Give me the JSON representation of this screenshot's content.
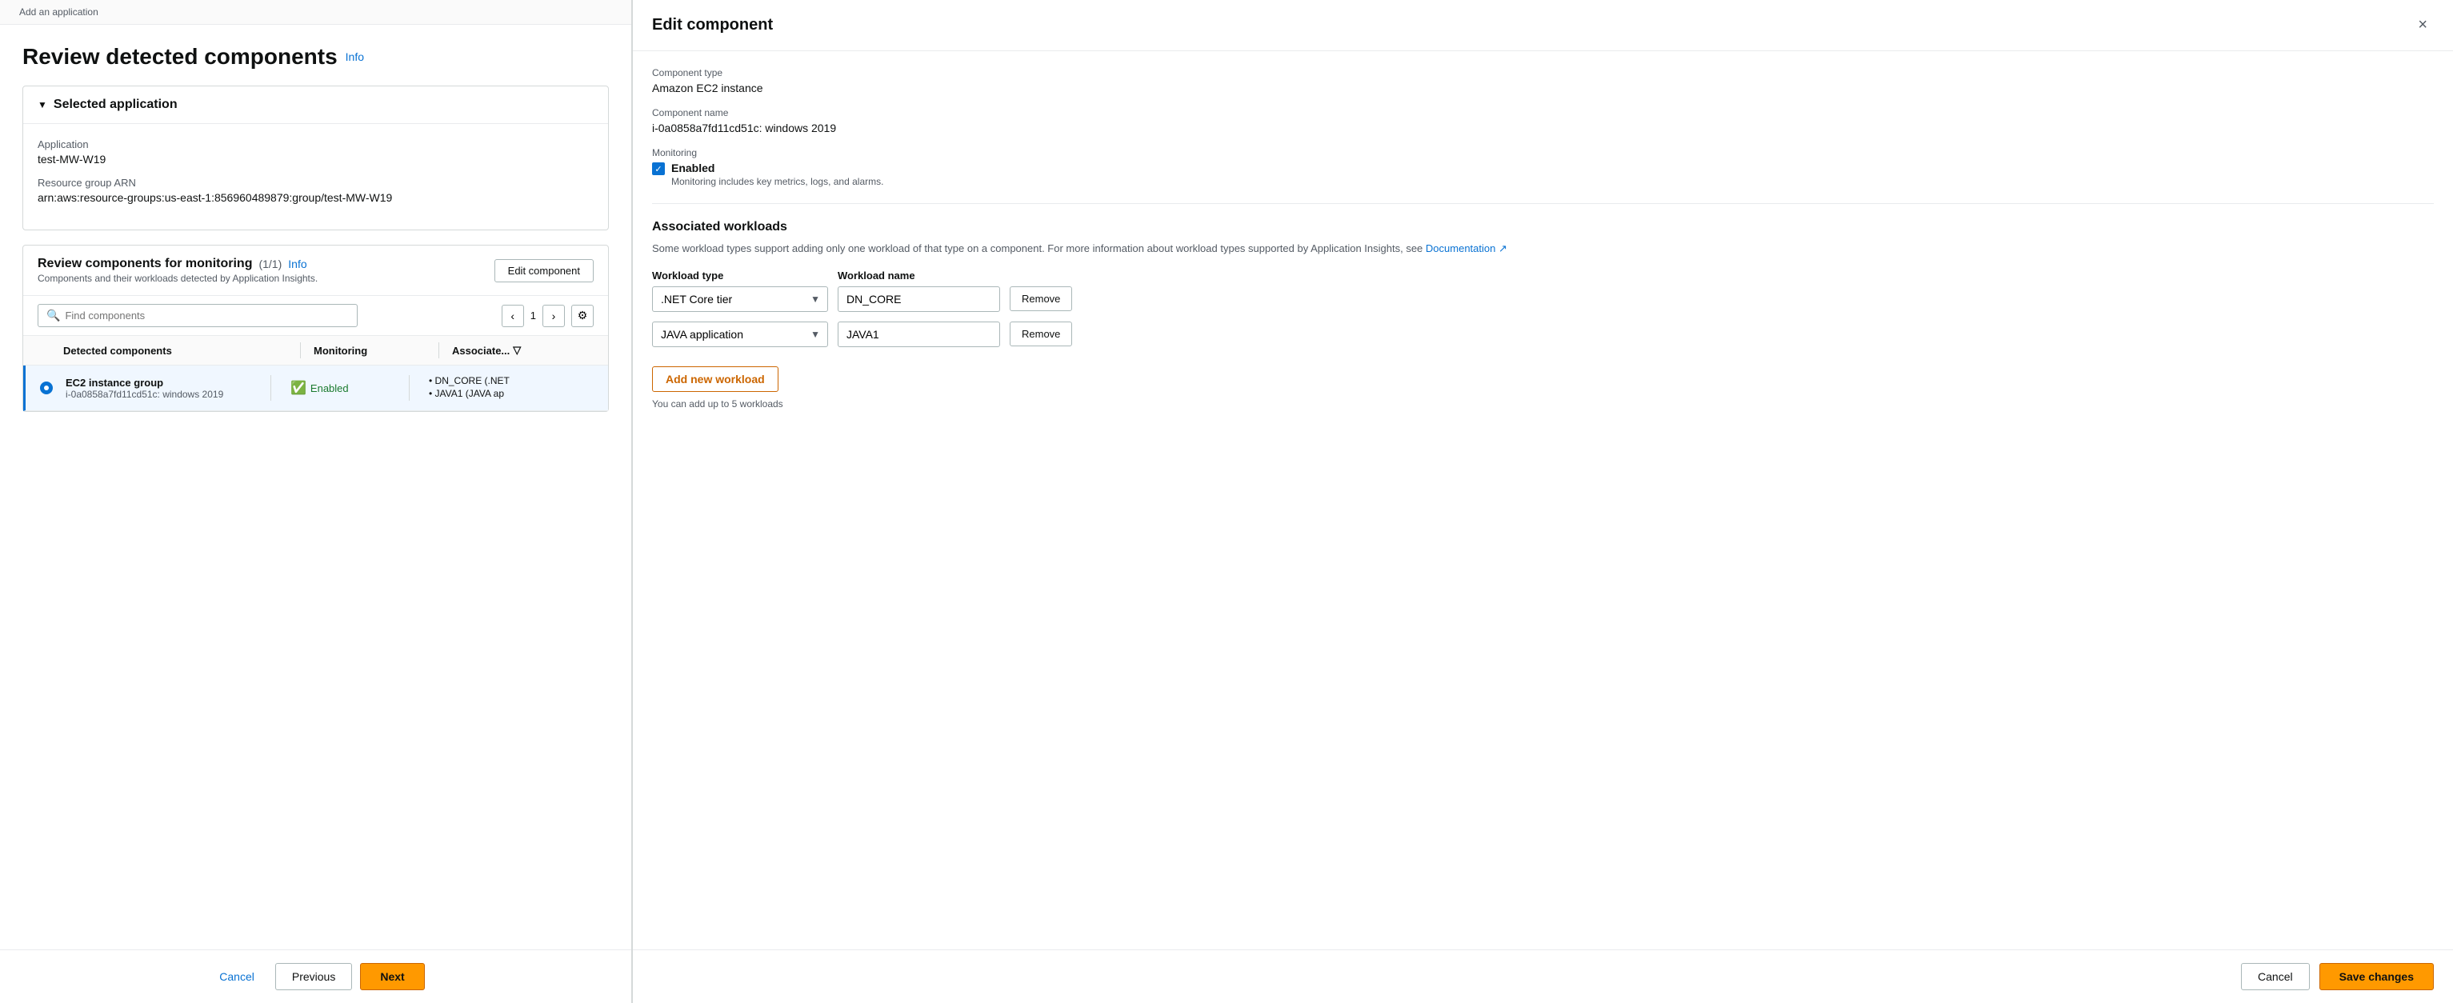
{
  "breadcrumb": "Add an application",
  "page": {
    "title": "Review detected components",
    "info_link": "Info"
  },
  "selected_application": {
    "section_title": "Selected application",
    "app_label": "Application",
    "app_value": "test-MW-W19",
    "arn_label": "Resource group ARN",
    "arn_value": "arn:aws:resource-groups:us-east-1:856960489879:group/test-MW-W19"
  },
  "components_section": {
    "title": "Review components for monitoring",
    "count": "(1/1)",
    "info_link": "Info",
    "subtitle": "Components and their workloads detected by Application Insights.",
    "edit_button": "Edit component",
    "search_placeholder": "Find components",
    "page_number": "1",
    "table": {
      "col_component": "Detected components",
      "col_monitoring": "Monitoring",
      "col_associate": "Associate...",
      "rows": [
        {
          "name": "EC2 instance group",
          "sub": "i-0a0858a7fd11cd51c: windows 2019",
          "monitoring": "Enabled",
          "workloads": [
            "DN_CORE (.NET",
            "JAVA1 (JAVA ap"
          ]
        }
      ]
    }
  },
  "footer": {
    "cancel": "Cancel",
    "previous": "Previous",
    "next": "Next"
  },
  "edit_component": {
    "title": "Edit component",
    "close_icon": "×",
    "component_type_label": "Component type",
    "component_type_value": "Amazon EC2 instance",
    "component_name_label": "Component name",
    "component_name_value": "i-0a0858a7fd11cd51c: windows 2019",
    "monitoring_label": "Monitoring",
    "monitoring_enabled": "Enabled",
    "monitoring_hint": "Monitoring includes key metrics, logs, and alarms.",
    "workloads_title": "Associated workloads",
    "workloads_desc_part1": "Some workload types support adding only one workload of that type on a component. For more information about workload types supported by Application Insights, see ",
    "workloads_doc_link": "Documentation",
    "wl_header_type": "Workload type",
    "wl_header_name": "Workload name",
    "workloads": [
      {
        "type": ".NET Core tier",
        "name": "DN_CORE",
        "remove": "Remove"
      },
      {
        "type": "JAVA application",
        "name": "JAVA1",
        "remove": "Remove"
      }
    ],
    "add_workload_btn": "Add new workload",
    "workload_limit_note": "You can add up to 5 workloads",
    "cancel_btn": "Cancel",
    "save_btn": "Save changes"
  }
}
